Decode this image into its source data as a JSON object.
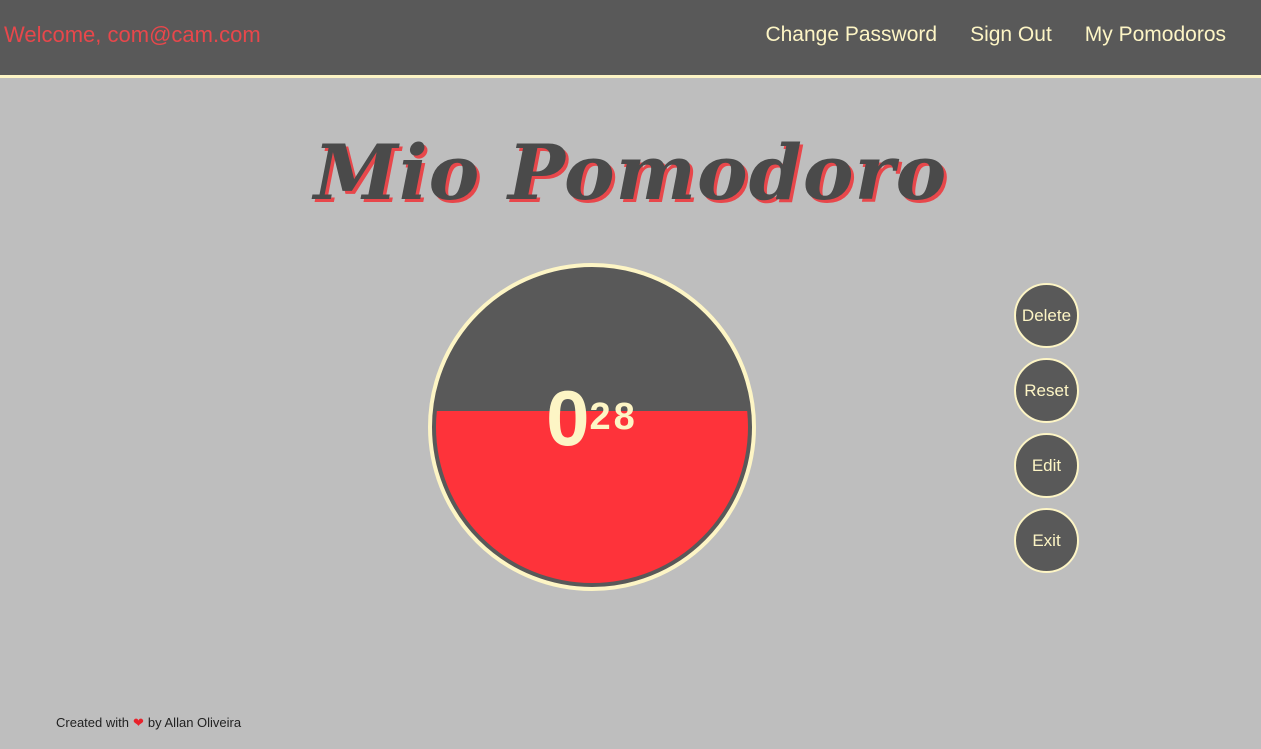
{
  "header": {
    "welcome": "Welcome, com@cam.com",
    "nav": [
      {
        "label": "Change Password"
      },
      {
        "label": "Sign Out"
      },
      {
        "label": "My Pomodoros"
      }
    ]
  },
  "main": {
    "title": "Mio Pomodoro",
    "timer": {
      "minutes": "0",
      "seconds": "28"
    },
    "actions": [
      {
        "label": "Delete"
      },
      {
        "label": "Reset"
      },
      {
        "label": "Edit"
      },
      {
        "label": "Exit"
      }
    ]
  },
  "footer": {
    "prefix": "Created with",
    "heart_icon": "heart-icon",
    "suffix": "by Allan Oliveira"
  },
  "colors": {
    "header_bg": "#595959",
    "page_bg": "#bebebe",
    "accent_red": "#fe333a",
    "cream": "#fdf5c5"
  }
}
